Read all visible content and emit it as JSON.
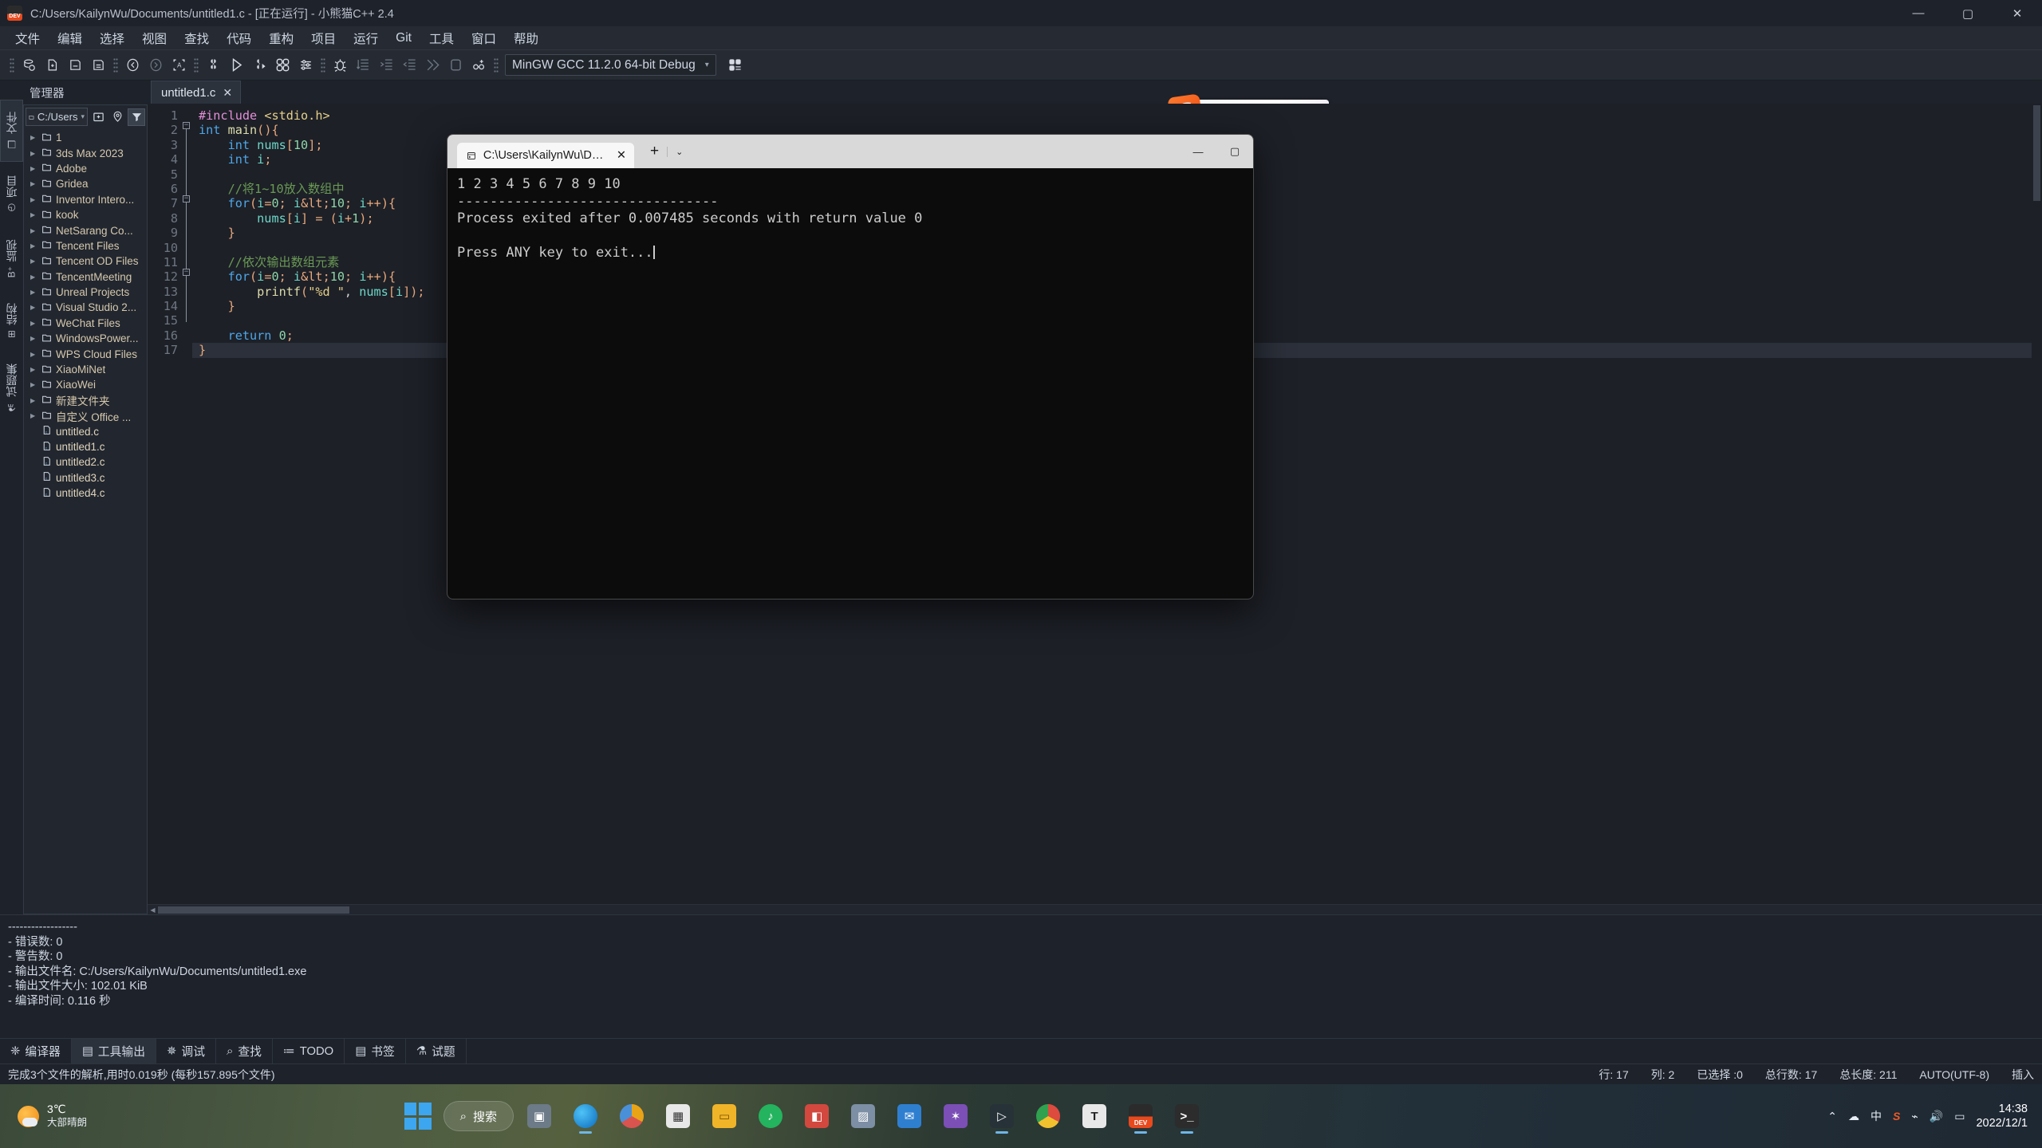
{
  "window": {
    "title": "C:/Users/KailynWu/Documents/untitled1.c - [正在运行] - 小熊猫C++ 2.4",
    "app_badge": "DEV",
    "minimize": "—",
    "maximize": "▢",
    "close": "✕"
  },
  "menu": {
    "items": [
      "文件",
      "编辑",
      "选择",
      "视图",
      "查找",
      "代码",
      "重构",
      "项目",
      "运行",
      "Git",
      "工具",
      "窗口",
      "帮助"
    ]
  },
  "toolbar": {
    "compiler_set": "MinGW GCC 11.2.0 64-bit Debug",
    "compiler_caret": "▾",
    "buttons": [
      "new-project-icon",
      "new-file-icon",
      "save-icon",
      "save-all-icon",
      "undo-icon",
      "redo-icon",
      "format-icon",
      "compile-icon",
      "run-icon",
      "compile-run-icon",
      "rebuild-icon",
      "options-icon",
      "debug-icon",
      "step-over-icon",
      "step-into-icon",
      "step-out-icon",
      "continue-icon",
      "stop-icon",
      "add-watch-icon",
      "compiler-options-icon"
    ]
  },
  "ime": {
    "logo": "S",
    "items": [
      "中",
      "°,",
      "mic-icon",
      "keyboard-icon",
      "skin-icon",
      "apps-icon"
    ]
  },
  "explorer": {
    "title": "管理器",
    "path": "C:/Users",
    "path_caret": "▾",
    "tool_new_folder": "new-folder-icon",
    "tool_locate": "locate-icon",
    "tool_filter": "filter-icon",
    "side_tabs": [
      {
        "label": "文件",
        "active": true
      },
      {
        "label": "项目",
        "active": false
      },
      {
        "label": "监视",
        "active": false
      },
      {
        "label": "结构",
        "active": false
      },
      {
        "label": "试题集",
        "active": false
      }
    ],
    "items": [
      {
        "name": "1",
        "type": "folder"
      },
      {
        "name": "3ds Max 2023",
        "type": "folder"
      },
      {
        "name": "Adobe",
        "type": "folder"
      },
      {
        "name": "Gridea",
        "type": "folder"
      },
      {
        "name": "Inventor Intero...",
        "type": "folder"
      },
      {
        "name": "kook",
        "type": "folder"
      },
      {
        "name": "NetSarang Co...",
        "type": "folder"
      },
      {
        "name": "Tencent Files",
        "type": "folder"
      },
      {
        "name": "Tencent OD Files",
        "type": "folder"
      },
      {
        "name": "TencentMeeting",
        "type": "folder"
      },
      {
        "name": "Unreal Projects",
        "type": "folder"
      },
      {
        "name": "Visual Studio 2...",
        "type": "folder"
      },
      {
        "name": "WeChat Files",
        "type": "folder"
      },
      {
        "name": "WindowsPower...",
        "type": "folder"
      },
      {
        "name": "WPS Cloud Files",
        "type": "folder"
      },
      {
        "name": "XiaoMiNet",
        "type": "folder"
      },
      {
        "name": "XiaoWei",
        "type": "folder"
      },
      {
        "name": "新建文件夹",
        "type": "folder"
      },
      {
        "name": "自定义 Office ...",
        "type": "folder"
      },
      {
        "name": "untitled.c",
        "type": "file"
      },
      {
        "name": "untitled1.c",
        "type": "file"
      },
      {
        "name": "untitled2.c",
        "type": "file"
      },
      {
        "name": "untitled3.c",
        "type": "file"
      },
      {
        "name": "untitled4.c",
        "type": "file"
      }
    ]
  },
  "editor": {
    "tab_label": "untitled1.c",
    "tab_close": "✕",
    "line_numbers": [
      1,
      2,
      3,
      4,
      5,
      6,
      7,
      8,
      9,
      10,
      11,
      12,
      13,
      14,
      15,
      16,
      17
    ],
    "code_lines": [
      "#include <stdio.h>",
      "int main(){",
      "    int nums[10];",
      "    int i;",
      "",
      "    //将1~10放入数组中",
      "    for(i=0; i<10; i++){",
      "        nums[i] = (i+1);",
      "    }",
      "",
      "    //依次输出数组元素",
      "    for(i=0; i<10; i++){",
      "        printf(\"%d \", nums[i]);",
      "    }",
      "",
      "    return 0;",
      "}"
    ]
  },
  "output_panel": {
    "lines": [
      "------------------",
      "- 错误数: 0",
      "- 警告数: 0",
      "- 输出文件名: C:/Users/KailynWu/Documents/untitled1.exe",
      "- 输出文件大小: 102.01 KiB",
      "- 编译时间: 0.116 秒"
    ]
  },
  "panel_tabs": [
    {
      "label": "编译器",
      "icon": "compiler-icon",
      "active": false
    },
    {
      "label": "工具输出",
      "icon": "tool-output-icon",
      "active": true
    },
    {
      "label": "调试",
      "icon": "debug-icon",
      "active": false
    },
    {
      "label": "查找",
      "icon": "search-icon",
      "active": false
    },
    {
      "label": "TODO",
      "icon": "todo-icon",
      "active": false
    },
    {
      "label": "书签",
      "icon": "bookmark-icon",
      "active": false
    },
    {
      "label": "试题",
      "icon": "flask-icon",
      "active": false
    }
  ],
  "statusbar": {
    "message": "完成3个文件的解析,用时0.019秒 (每秒157.895个文件)",
    "row": "行: 17",
    "col": "列: 2",
    "selected": "已选择 :0",
    "total_rows": "总行数: 17",
    "total_len": "总长度: 211",
    "encoding": "AUTO(UTF-8)",
    "insert_mode": "插入"
  },
  "terminal": {
    "tab_title": "C:\\Users\\KailynWu\\Documents",
    "tab_icon": "console-icon",
    "tab_close": "✕",
    "new_tab": "+",
    "dropdown": "⌄",
    "minimize": "—",
    "maximize": "▢",
    "lines": [
      "1 2 3 4 5 6 7 8 9 10",
      "--------------------------------",
      "Process exited after 0.007485 seconds with return value 0",
      "",
      "Press ANY key to exit..."
    ]
  },
  "taskbar": {
    "weather_temp": "3℃",
    "weather_desc": "大部晴朗",
    "search_label": "搜索",
    "search_icon": "search-icon",
    "apps": [
      {
        "name": "task-view-icon",
        "label": "",
        "color": "#6d7a88",
        "running": false
      },
      {
        "name": "edge-icon",
        "label": "",
        "color": "#1b7ec2",
        "running": true
      },
      {
        "name": "chrome-canary-icon",
        "label": "",
        "color": "#e8a317",
        "running": false
      },
      {
        "name": "microsoft-store-icon",
        "label": "",
        "color": "#d9d9d9",
        "running": false
      },
      {
        "name": "file-explorer-icon",
        "label": "",
        "color": "#f0b429",
        "running": false
      },
      {
        "name": "netease-music-icon",
        "label": "",
        "color": "#24b35e",
        "running": false
      },
      {
        "name": "office-icon",
        "label": "",
        "color": "#d2483f",
        "running": false
      },
      {
        "name": "photos-icon",
        "label": "",
        "color": "#7d8fa4",
        "running": false
      },
      {
        "name": "mail-icon",
        "label": "",
        "color": "#2f7fd1",
        "running": false
      },
      {
        "name": "visual-studio-icon",
        "label": "",
        "color": "#7b4fb5",
        "running": false
      },
      {
        "name": "pycharm-icon",
        "label": "",
        "color": "#3a4a5c",
        "running": true
      },
      {
        "name": "chrome-icon",
        "label": "",
        "color": "#dd4b3e",
        "running": false
      },
      {
        "name": "typora-icon",
        "label": "T",
        "color": "#e8e8e8",
        "running": false
      },
      {
        "name": "dev-cpp-icon",
        "label": "DEV",
        "color": "#e8491d",
        "running": true
      },
      {
        "name": "windows-terminal-icon",
        "label": "",
        "color": "#2c2c2c",
        "running": true
      }
    ],
    "tray": [
      "chevron-up-icon",
      "cloud-icon",
      "ime-cn-icon",
      "sogou-icon",
      "wifi-icon",
      "volume-icon",
      "battery-icon"
    ],
    "ime_label": "中",
    "clock_time": "14:38",
    "clock_date": "2022/12/1"
  }
}
